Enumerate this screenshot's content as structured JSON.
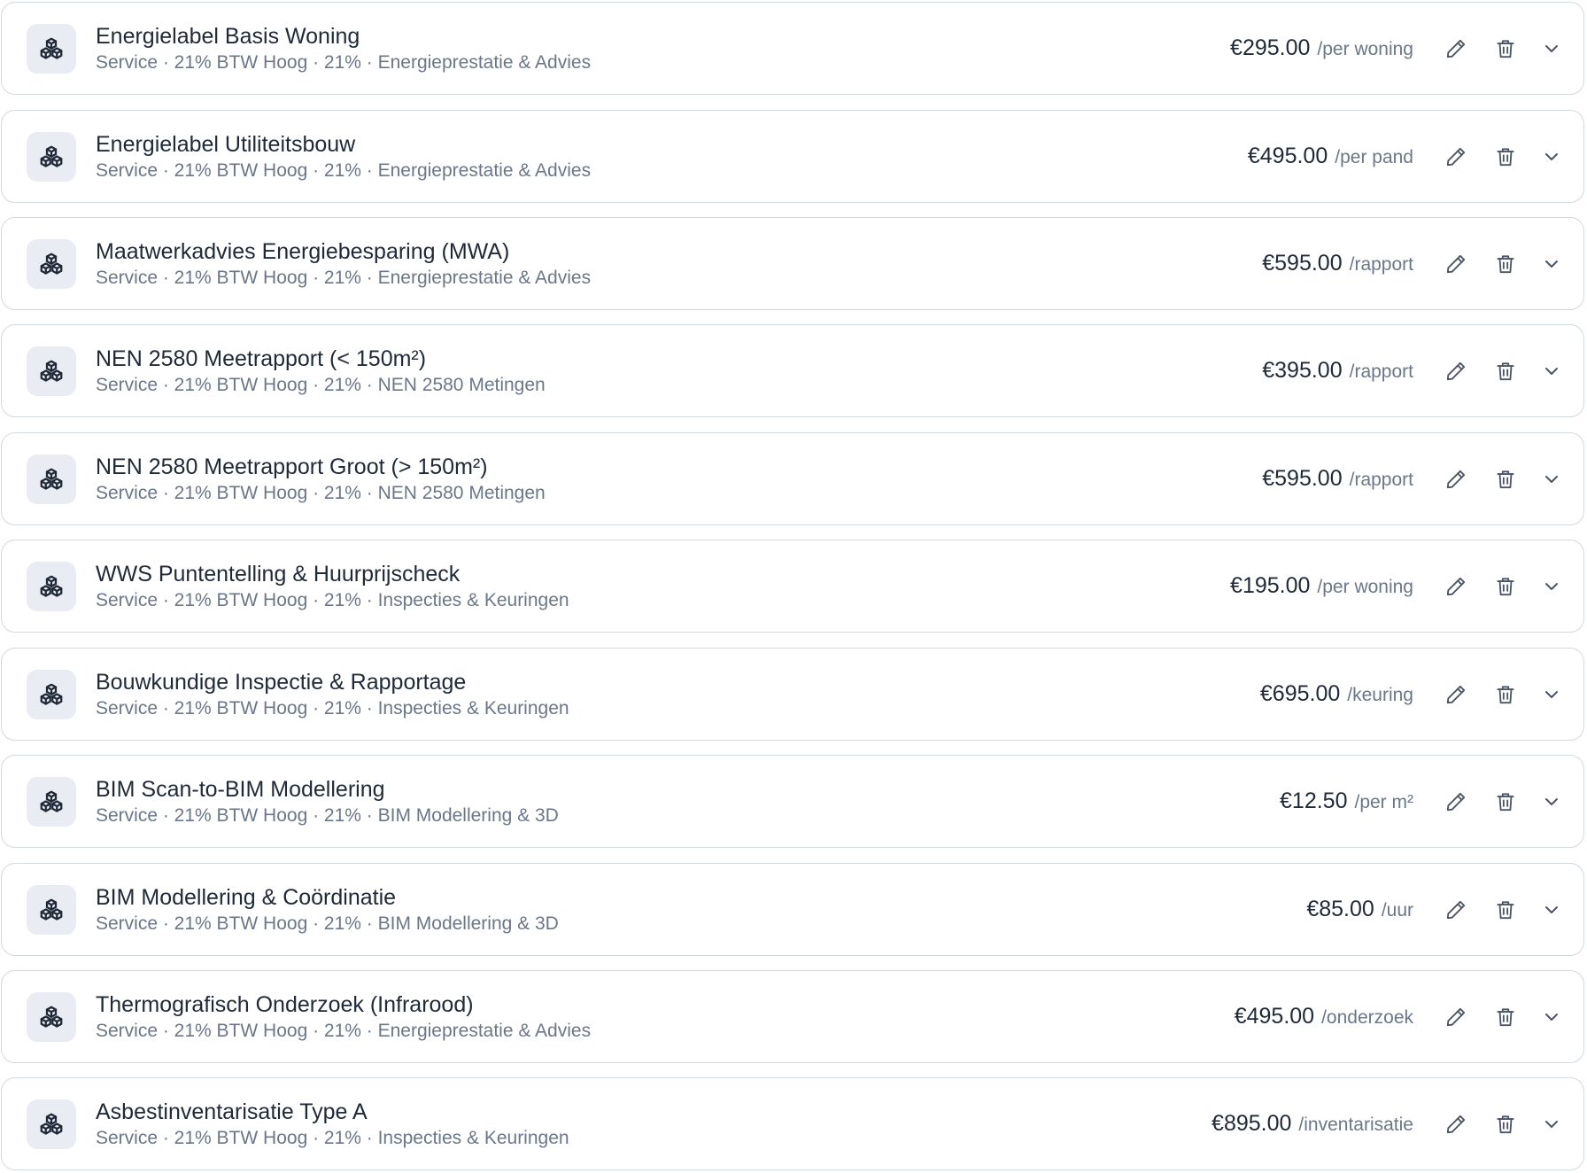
{
  "icons": {
    "item": "boxes-icon",
    "edit": "pencil-icon",
    "delete": "trash-icon",
    "expand": "chevron-down-icon"
  },
  "colors": {
    "border": "#d3d9e1",
    "icon_bg": "#e9edf3",
    "title_text": "#1f2937",
    "meta_text": "#6b7788"
  },
  "items": [
    {
      "title": "Energielabel Basis Woning",
      "meta": "Service · 21% BTW Hoog · 21% · Energieprestatie & Advies",
      "price": "€295.00",
      "unit": "/per woning"
    },
    {
      "title": "Energielabel Utiliteitsbouw",
      "meta": "Service · 21% BTW Hoog · 21% · Energieprestatie & Advies",
      "price": "€495.00",
      "unit": "/per pand"
    },
    {
      "title": "Maatwerkadvies Energiebesparing (MWA)",
      "meta": "Service · 21% BTW Hoog · 21% · Energieprestatie & Advies",
      "price": "€595.00",
      "unit": "/rapport"
    },
    {
      "title": "NEN 2580 Meetrapport (< 150m²)",
      "meta": "Service · 21% BTW Hoog · 21% · NEN 2580 Metingen",
      "price": "€395.00",
      "unit": "/rapport"
    },
    {
      "title": "NEN 2580 Meetrapport Groot (> 150m²)",
      "meta": "Service · 21% BTW Hoog · 21% · NEN 2580 Metingen",
      "price": "€595.00",
      "unit": "/rapport"
    },
    {
      "title": "WWS Puntentelling & Huurprijscheck",
      "meta": "Service · 21% BTW Hoog · 21% · Inspecties & Keuringen",
      "price": "€195.00",
      "unit": "/per woning"
    },
    {
      "title": "Bouwkundige Inspectie & Rapportage",
      "meta": "Service · 21% BTW Hoog · 21% · Inspecties & Keuringen",
      "price": "€695.00",
      "unit": "/keuring"
    },
    {
      "title": "BIM Scan-to-BIM Modellering",
      "meta": "Service · 21% BTW Hoog · 21% · BIM Modellering & 3D",
      "price": "€12.50",
      "unit": "/per m²"
    },
    {
      "title": "BIM Modellering & Coördinatie",
      "meta": "Service · 21% BTW Hoog · 21% · BIM Modellering & 3D",
      "price": "€85.00",
      "unit": "/uur"
    },
    {
      "title": "Thermografisch Onderzoek (Infrarood)",
      "meta": "Service · 21% BTW Hoog · 21% · Energieprestatie & Advies",
      "price": "€495.00",
      "unit": "/onderzoek"
    },
    {
      "title": "Asbestinventarisatie Type A",
      "meta": "Service · 21% BTW Hoog · 21% · Inspecties & Keuringen",
      "price": "€895.00",
      "unit": "/inventarisatie"
    }
  ]
}
